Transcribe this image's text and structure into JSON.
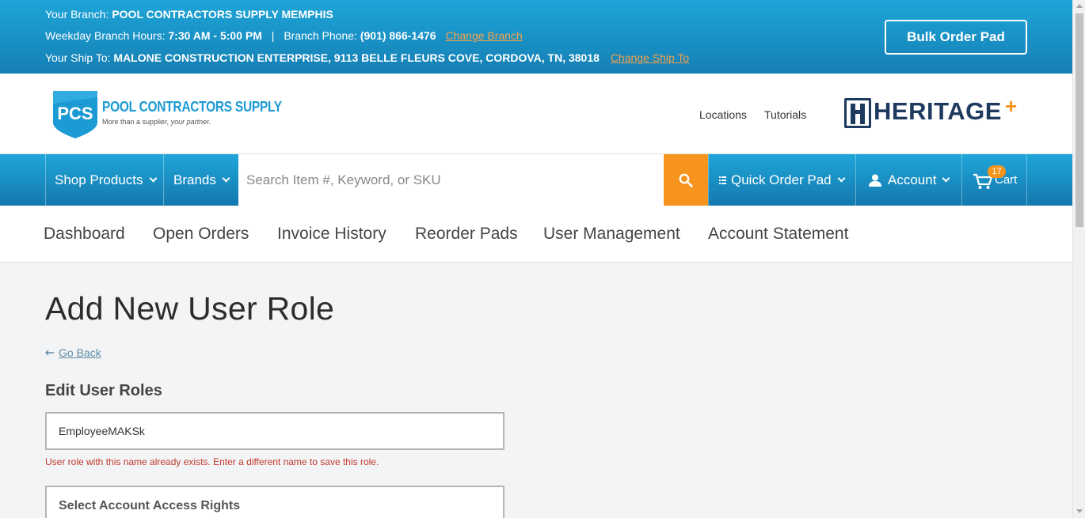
{
  "topbar": {
    "branch_label": "Your Branch:",
    "branch_name": "POOL CONTRACTORS SUPPLY MEMPHIS",
    "hours_label": "Weekday Branch Hours:",
    "hours_value": "7:30 AM - 5:00 PM",
    "separator": "|",
    "phone_label": "Branch Phone:",
    "phone_value": "(901) 866-1476",
    "change_branch": "Change Branch",
    "shipto_label": "Your Ship To:",
    "shipto_value": "MALONE CONSTRUCTION ENTERPRISE, 9113 BELLE FLEURS COVE, CORDOVA, TN, 38018",
    "change_shipto": "Change Ship To",
    "bulk_order_pad": "Bulk Order Pad"
  },
  "header": {
    "logo_mark": "PCS",
    "logo_name": "POOL CONTRACTORS SUPPLY",
    "logo_tagline_a": "More than a supplier, ",
    "logo_tagline_b": "your partner.",
    "locations": "Locations",
    "tutorials": "Tutorials",
    "heritage": "HERITAGE",
    "heritage_plus": "+"
  },
  "nav": {
    "shop_products": "Shop Products",
    "brands": "Brands",
    "search_placeholder": "Search Item #, Keyword, or SKU",
    "quick_order_pad": "Quick Order Pad",
    "account": "Account",
    "cart": "Cart",
    "cart_count": "17"
  },
  "subnav": {
    "tabs": [
      "Dashboard",
      "Open Orders",
      "Invoice History",
      "Reorder Pads",
      "User Management",
      "Account Statement"
    ]
  },
  "main": {
    "title": "Add New User Role",
    "go_back": "Go Back",
    "section_title": "Edit User Roles",
    "role_name_value": "EmployeeMAKSk",
    "error_message": "User role with this name already exists. Enter a different name to save this role.",
    "access_rights_label": "Select Account Access Rights"
  },
  "colors": {
    "primary_blue": "#1b9ad4",
    "accent_orange": "#f7941d",
    "error_red": "#c0392b",
    "heritage_navy": "#1e3a5f"
  }
}
